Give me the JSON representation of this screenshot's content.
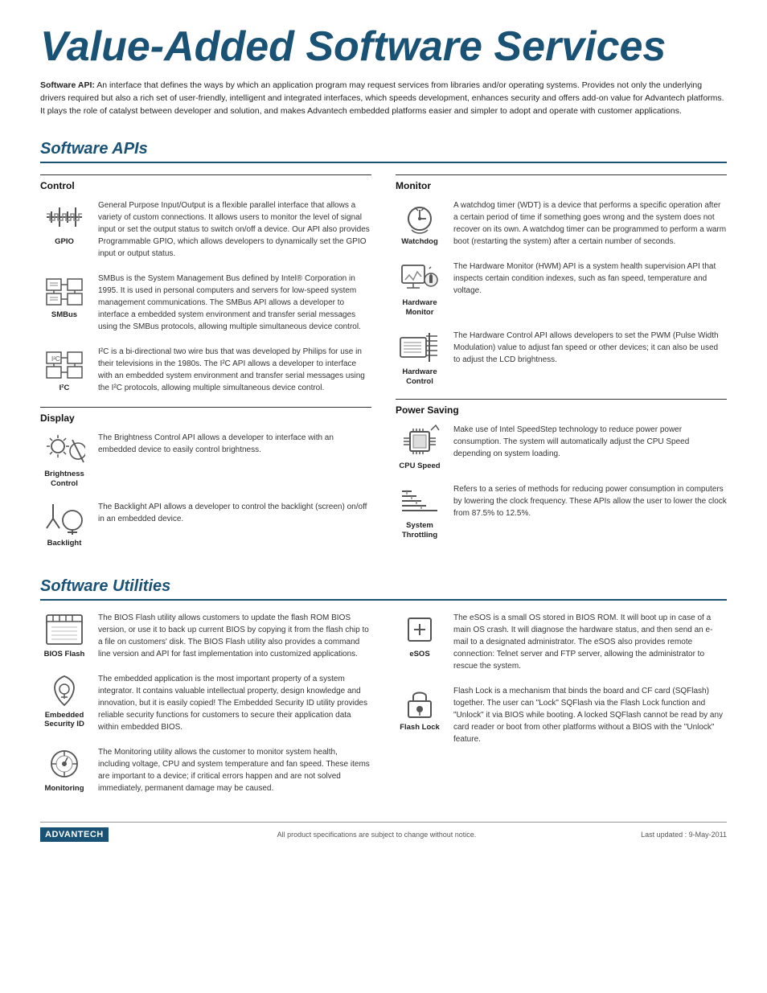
{
  "page": {
    "title": "Value-Added Software Services",
    "intro_label": "Software API:",
    "intro_text": "An interface that defines the ways by which an application program may request services from libraries and/or operating systems. Provides not only the underlying drivers required but also a rich set of user-friendly, intelligent and integrated interfaces, which speeds development, enhances security and offers add-on value for Advantech platforms. It plays the role of catalyst between developer and solution, and makes Advantech embedded platforms easier and simpler to adopt and operate with customer applications.",
    "software_apis_title": "Software APIs",
    "software_utilities_title": "Software Utilities",
    "control_title": "Control",
    "monitor_title": "Monitor",
    "display_title": "Display",
    "power_saving_title": "Power Saving",
    "control_items": [
      {
        "name": "GPIO",
        "desc": "General Purpose Input/Output is a flexible parallel interface that allows a variety of custom connections. It allows users to monitor the level of signal input or set the output status to switch on/off a device. Our API also provides Programmable GPIO, which allows developers to dynamically set the GPIO input or output status."
      },
      {
        "name": "SMBus",
        "desc": "SMBus is the System Management Bus defined by Intel® Corporation in 1995. It is used in personal computers and servers for low-speed system management communications. The SMBus API allows a developer to interface a embedded system environment and transfer serial messages using the SMBus protocols, allowing multiple simultaneous device control."
      },
      {
        "name": "I²C",
        "desc": "I²C is a bi-directional two wire bus that was developed by Philips for use in their televisions in the 1980s. The I²C API allows a developer to interface with an embedded system environment and transfer serial messages using the I²C protocols, allowing multiple simultaneous device control."
      }
    ],
    "monitor_items": [
      {
        "name": "Watchdog",
        "desc": "A watchdog timer (WDT) is a device that performs a specific operation after a certain period of time if something goes wrong and the system does not recover on its own. A watchdog timer can be programmed to perform a warm boot (restarting the system) after a certain number of seconds."
      },
      {
        "name": "Hardware\nMonitor",
        "desc": "The Hardware Monitor (HWM) API is a system health supervision API that inspects certain condition indexes, such as fan speed, temperature and voltage."
      },
      {
        "name": "Hardware\nControl",
        "desc": "The Hardware Control API allows developers to set the PWM (Pulse Width Modulation) value to adjust fan speed or other devices; it can also be used to adjust the LCD brightness."
      }
    ],
    "display_items": [
      {
        "name": "Brightness\nControl",
        "desc": "The Brightness Control API allows a developer to interface with an embedded device to easily control brightness."
      },
      {
        "name": "Backlight",
        "desc": "The Backlight API allows a developer to control the backlight (screen) on/off in an embedded device."
      }
    ],
    "power_saving_items": [
      {
        "name": "CPU Speed",
        "desc": "Make use of Intel SpeedStep technology to reduce power power consumption. The system will automatically adjust the CPU Speed depending on system loading."
      },
      {
        "name": "System\nThrottling",
        "desc": "Refers to a series of methods for reducing power consumption in computers by lowering the clock frequency. These APIs allow the user to lower the clock from 87.5% to 12.5%."
      }
    ],
    "utilities_left": [
      {
        "name": "BIOS Flash",
        "desc": "The BIOS Flash utility allows customers to update the flash ROM BIOS version, or use it to back up current BIOS by copying it from the flash chip to a file on customers' disk. The BIOS Flash utility also provides a command line version and API for fast implementation into customized applications."
      },
      {
        "name": "Embedded\nSecurity ID",
        "desc": "The embedded application is the most important property of a system integrator. It contains valuable intellectual property, design knowledge and innovation, but it is easily copied! The Embedded Security ID utility provides reliable security functions for customers to secure their application data within embedded BIOS."
      },
      {
        "name": "Monitoring",
        "desc": "The Monitoring utility allows the customer to monitor system health, including voltage, CPU and system temperature and fan speed. These items are important to a device; if critical errors happen and are not solved immediately, permanent damage may be caused."
      }
    ],
    "utilities_right": [
      {
        "name": "eSOS",
        "desc": "The eSOS is a small OS stored in BIOS ROM. It will boot up in case of a main OS crash. It will diagnose the hardware status, and then send an e-mail to a designated administrator. The eSOS also provides remote connection: Telnet server and FTP server, allowing the administrator to rescue the system."
      },
      {
        "name": "Flash Lock",
        "desc": "Flash Lock is a mechanism that binds the board and CF card (SQFlash) together. The user can \"Lock\" SQFlash via the Flash Lock function and \"Unlock\" it via BIOS while booting. A locked SQFlash cannot be read by any card reader or boot from other platforms without a BIOS with the \"Unlock\" feature."
      }
    ],
    "footer": {
      "logo": "ADVANTECH",
      "disclaimer": "All product specifications are subject to change without notice.",
      "updated": "Last updated : 9-May-2011"
    }
  }
}
